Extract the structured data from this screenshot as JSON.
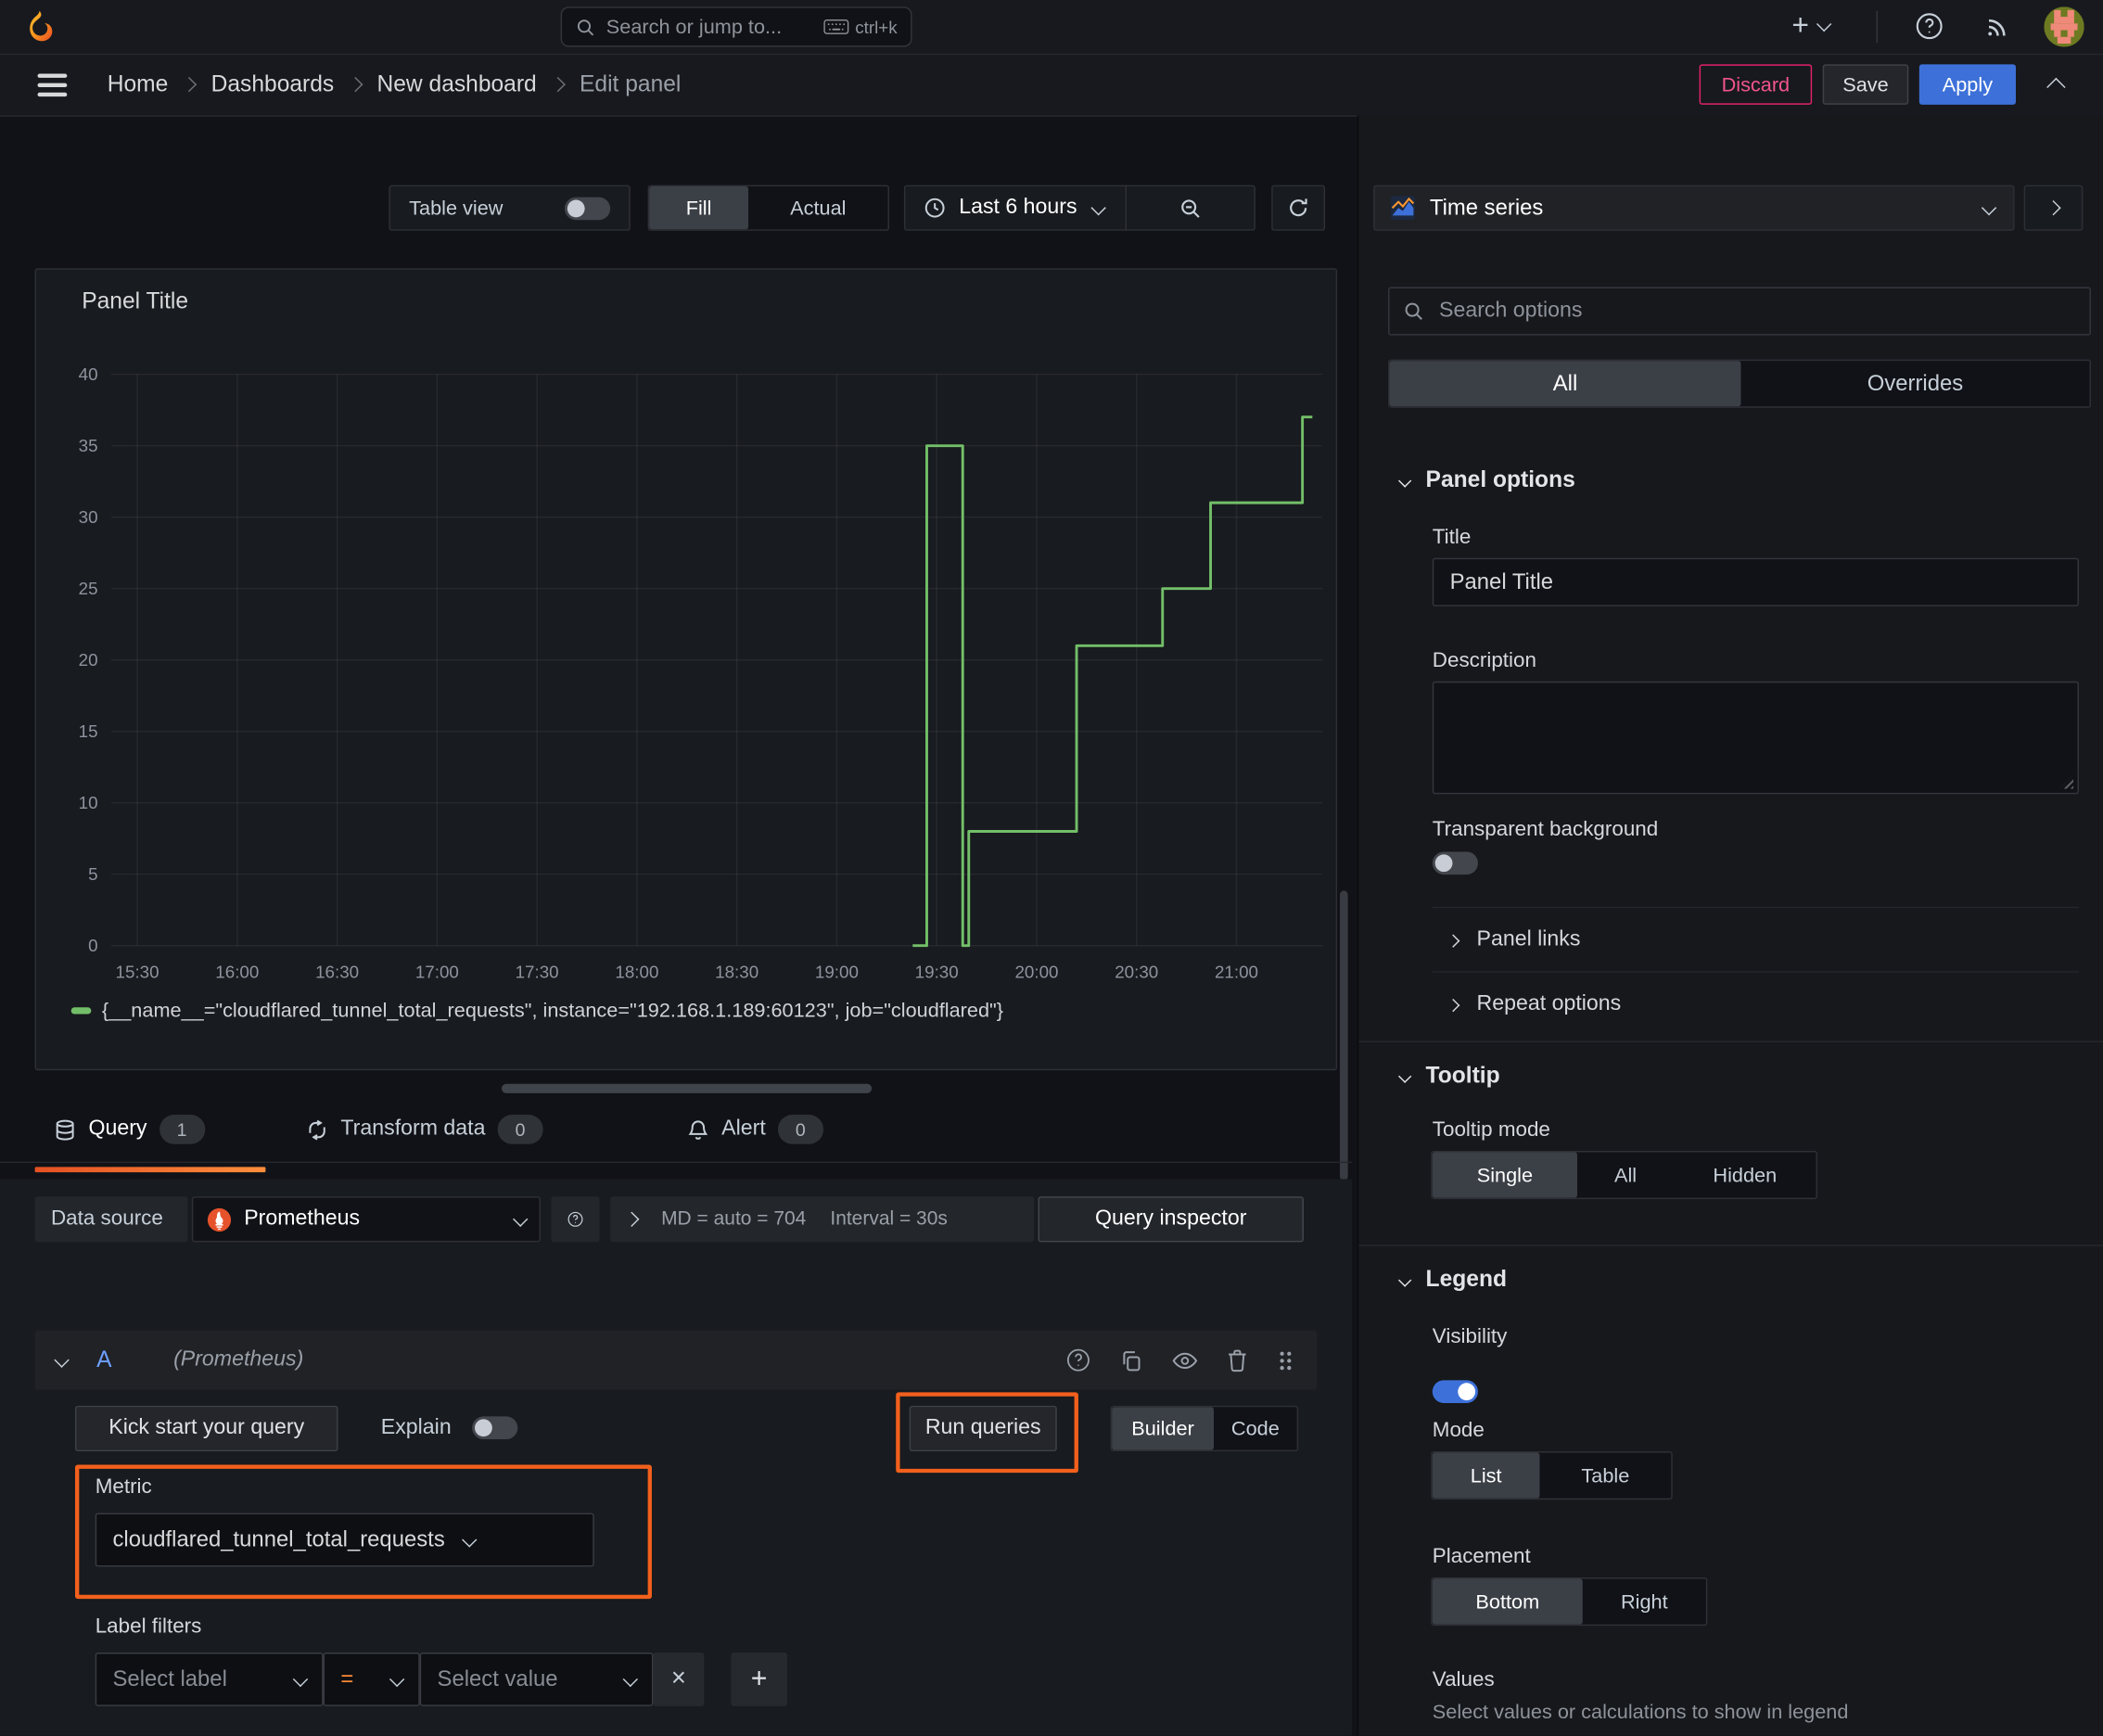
{
  "topbar": {
    "search_placeholder": "Search or jump to...",
    "search_shortcut": "ctrl+k"
  },
  "breadcrumb": {
    "items": [
      "Home",
      "Dashboards",
      "New dashboard",
      "Edit panel"
    ],
    "discard_label": "Discard",
    "save_label": "Save",
    "apply_label": "Apply"
  },
  "toolbar": {
    "table_view_label": "Table view",
    "fill_label": "Fill",
    "actual_label": "Actual",
    "time_range_label": "Last 6 hours"
  },
  "viz_picker": {
    "name": "Time series",
    "search_placeholder": "Search options",
    "tab_all": "All",
    "tab_overrides": "Overrides"
  },
  "panel": {
    "title": "Panel Title"
  },
  "chart_data": {
    "type": "line",
    "line_style": "step",
    "title": "Panel Title",
    "series": [
      {
        "name": "{__name__=\"cloudflared_tunnel_total_requests\", instance=\"192.168.1.189:60123\", job=\"cloudflared\"}",
        "color": "#73bf69",
        "points_hour_value": [
          [
            19.38,
            0
          ],
          [
            19.45,
            0
          ],
          [
            19.45,
            35
          ],
          [
            19.63,
            35
          ],
          [
            19.63,
            0
          ],
          [
            19.66,
            0
          ],
          [
            19.66,
            8
          ],
          [
            20.2,
            8
          ],
          [
            20.2,
            21
          ],
          [
            20.63,
            21
          ],
          [
            20.63,
            25
          ],
          [
            20.87,
            25
          ],
          [
            20.87,
            31
          ],
          [
            21.33,
            31
          ],
          [
            21.33,
            37
          ],
          [
            21.38,
            37
          ]
        ]
      }
    ],
    "xlim_hours": [
      15.37,
      21.43
    ],
    "ylim": [
      0,
      40
    ],
    "yticks": [
      0,
      5,
      10,
      15,
      20,
      25,
      30,
      35,
      40
    ],
    "xtick_hours": [
      15.5,
      16,
      16.5,
      17,
      17.5,
      18,
      18.5,
      19,
      19.5,
      20,
      20.5,
      21
    ],
    "xtick_labels": [
      "15:30",
      "16:00",
      "16:30",
      "17:00",
      "17:30",
      "18:00",
      "18:30",
      "19:00",
      "19:30",
      "20:00",
      "20:30",
      "21:00"
    ],
    "grid": true,
    "legend_position": "bottom"
  },
  "tabs": {
    "query_label": "Query",
    "query_count": "1",
    "transform_label": "Transform data",
    "transform_count": "0",
    "alert_label": "Alert",
    "alert_count": "0"
  },
  "query": {
    "datasource_label": "Data source",
    "datasource_name": "Prometheus",
    "stats_text": "MD = auto = 704",
    "interval_text": "Interval = 30s",
    "inspector_label": "Query inspector",
    "ref_id": "A",
    "ds_hint": "(Prometheus)",
    "kickstart_label": "Kick start your query",
    "explain_label": "Explain",
    "run_label": "Run queries",
    "builder_label": "Builder",
    "code_label": "Code",
    "metric_label": "Metric",
    "metric_value": "cloudflared_tunnel_total_requests",
    "label_filters_label": "Label filters",
    "select_label_placeholder": "Select label",
    "operator_value": "=",
    "select_value_placeholder": "Select value"
  },
  "options": {
    "panel_options_header": "Panel options",
    "title_label": "Title",
    "title_value": "Panel Title",
    "description_label": "Description",
    "transparent_label": "Transparent background",
    "panel_links_label": "Panel links",
    "repeat_label": "Repeat options",
    "tooltip_header": "Tooltip",
    "tooltip_mode_label": "Tooltip mode",
    "tooltip_options": [
      "Single",
      "All",
      "Hidden"
    ],
    "legend_header": "Legend",
    "visibility_label": "Visibility",
    "mode_label": "Mode",
    "mode_options": [
      "List",
      "Table"
    ],
    "placement_label": "Placement",
    "placement_options": [
      "Bottom",
      "Right"
    ],
    "values_label": "Values",
    "values_hint": "Select values or calculations to show in legend"
  },
  "colors": {
    "series_green": "#73bf69",
    "primary_blue": "#3d71d9",
    "annotation_orange": "#f2601c",
    "discard_pink": "#e0226c",
    "tab_underline_start": "#e55123",
    "tab_underline_end": "#ff8e3c"
  }
}
